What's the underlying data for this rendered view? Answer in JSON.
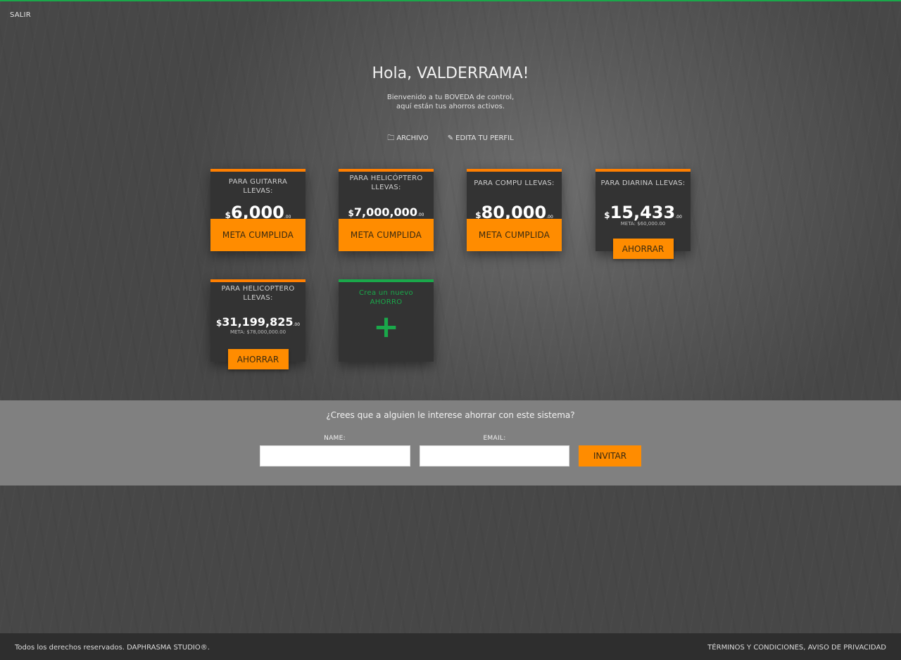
{
  "header": {
    "logout_label": "SALIR"
  },
  "greeting": "Hola, VALDERRAMA!",
  "welcome_line1": "Bienvenido a tu BOVEDA de control,",
  "welcome_line2": "aquí están tus ahorros activos.",
  "links": {
    "archive_label": "ARCHIVO",
    "archive_icon": "folder-icon",
    "profile_label": "EDITA TU PERFIL",
    "profile_icon": "edit-icon"
  },
  "cards": [
    {
      "label": "PARA GUITARRA LLEVAS:",
      "currency": "$",
      "amount": "6,000",
      "cents": ".00",
      "goal": "",
      "status": "META CUMPLIDA"
    },
    {
      "label": "PARA HELICÓPTERO LLEVAS:",
      "currency": "$",
      "amount": "7,000,000",
      "cents": ".00",
      "goal": "",
      "status": "META CUMPLIDA"
    },
    {
      "label": "PARA COMPU LLEVAS:",
      "currency": "$",
      "amount": "80,000",
      "cents": ".00",
      "goal": "",
      "status": "META CUMPLIDA"
    },
    {
      "label": "PARA DIARINA LLEVAS:",
      "currency": "$",
      "amount": "15,433",
      "cents": ".00",
      "goal": "META: $60,000.00",
      "action": "AHORRAR"
    },
    {
      "label": "PARA HELICOPTERO LLEVAS:",
      "currency": "$",
      "amount": "31,199,825",
      "cents": ".00",
      "goal": "META: $78,000,000.00",
      "action": "AHORRAR"
    }
  ],
  "new_card": {
    "label": "Crea un nuevo AHORRO",
    "plus": "+"
  },
  "invite": {
    "question": "¿Crees que a alguien le interese ahorrar con este sistema?",
    "name_label": "NAME:",
    "email_label": "EMAIL:",
    "name_value": "",
    "email_value": "",
    "button": "INVITAR"
  },
  "footer": {
    "copyright": "Todos los derechos reservados. DAPHRASMA STUDIO®.",
    "legal": "TÉRMINOS Y CONDICIONES, AVISO DE PRIVACIDAD"
  },
  "colors": {
    "accent": "#ff8c00",
    "new": "#1aa84a",
    "card": "#333333"
  }
}
